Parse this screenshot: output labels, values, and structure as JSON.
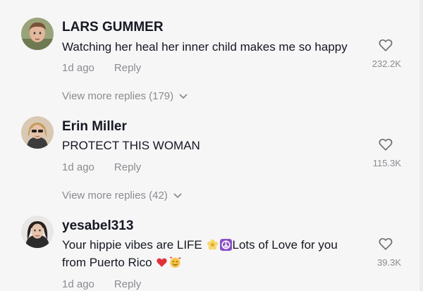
{
  "comments": [
    {
      "username": "LARS GUMMER",
      "text": "Watching her heal her inner child makes me so happy",
      "time": "1d ago",
      "reply_label": "Reply",
      "likes": "232.2K",
      "view_replies": "View more replies (179)"
    },
    {
      "username": "Erin Miller",
      "text": "PROTECT THIS WOMAN",
      "time": "1d ago",
      "reply_label": "Reply",
      "likes": "115.3K",
      "view_replies": "View more replies (42)"
    },
    {
      "username": "yesabel313",
      "text_part1": "Your hippie vibes are LIFE",
      "text_part2": "Lots of Love for you",
      "text_line2": "from Puerto Rico",
      "time": "1d ago",
      "reply_label": "Reply",
      "likes": "39.3K"
    }
  ],
  "icons": {
    "like": "heart-outline-icon",
    "expand": "chevron-down-icon",
    "emoji_1": "blossom-emoji-icon",
    "emoji_2": "peace-symbol-emoji-icon",
    "emoji_3": "red-heart-emoji-icon",
    "emoji_4": "smiling-face-with-hearts-emoji-icon"
  },
  "colors": {
    "background": "#f6f6f6",
    "primary_text": "#161823",
    "secondary_text": "#8a8b91"
  }
}
